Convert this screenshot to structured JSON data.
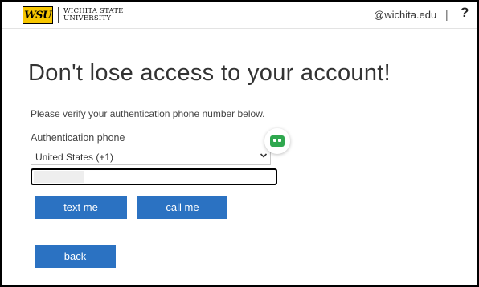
{
  "header": {
    "logo_mark": "WSU",
    "logo_line1": "Wichita State",
    "logo_line2": "University",
    "domain": "@wichita.edu",
    "separator": "|",
    "help": "?"
  },
  "main": {
    "title": "Don't lose access to your account!",
    "instruction": "Please verify your authentication phone number below.",
    "phone_label": "Authentication phone",
    "country_selected": "United States (+1)",
    "phone_value": ""
  },
  "buttons": {
    "text_me": "text me",
    "call_me": "call me",
    "back": "back"
  },
  "colors": {
    "button_blue": "#2b72c2",
    "logo_yellow": "#f7c600",
    "badge_green": "#2fa84f"
  },
  "icons": {
    "help": "question-mark-icon",
    "dropdown": "chevron-down-icon",
    "extension": "password-manager-badge-icon"
  }
}
